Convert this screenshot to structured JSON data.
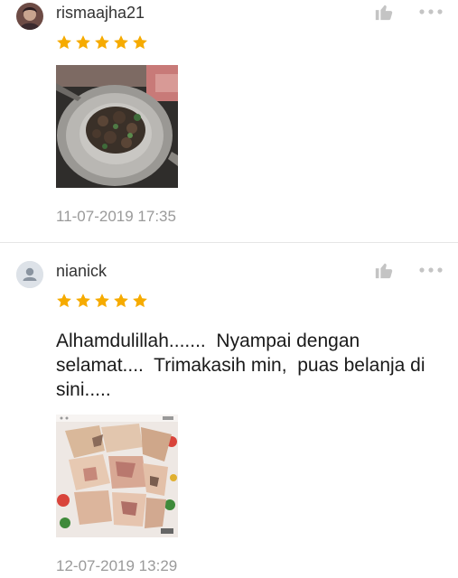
{
  "reviews": [
    {
      "username": "rismaajha21",
      "rating": 5,
      "avatar_icon": "user-photo-avatar",
      "comment": "",
      "photo_icon": "wok-stir-fry-photo",
      "timestamp": "11-07-2019 17:35"
    },
    {
      "username": "nianick",
      "rating": 5,
      "avatar_icon": "default-user-avatar",
      "comment": "Alhamdulillah.......  Nyampai dengan selamat....  Trimakasih min,  puas belanja di sini.....",
      "photo_icon": "raw-fish-chunks-photo",
      "timestamp": "12-07-2019 13:29"
    }
  ],
  "icons": {
    "like": "thumbs-up-icon",
    "more": "more-dots-icon",
    "star": "star-icon"
  },
  "colors": {
    "star": "#f6ab00",
    "icon_gray": "#c4c4c4",
    "timestamp": "#9a9a9a",
    "divider": "#e6e6e6"
  }
}
